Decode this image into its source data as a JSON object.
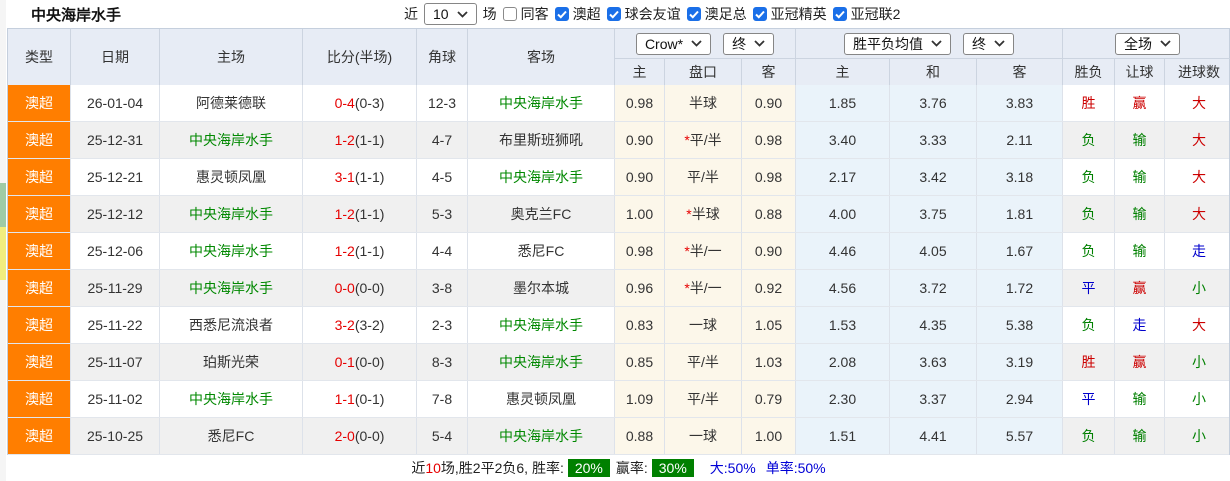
{
  "title": "中央海岸水手",
  "controls": {
    "recent_label": "近",
    "recent_count": "10",
    "unit_label": "场",
    "same_away": {
      "label": "同客",
      "checked": false
    },
    "leagues": [
      {
        "label": "澳超",
        "checked": true
      },
      {
        "label": "球会友谊",
        "checked": true
      },
      {
        "label": "澳足总",
        "checked": true
      },
      {
        "label": "亚冠精英",
        "checked": true
      },
      {
        "label": "亚冠联2",
        "checked": true
      }
    ]
  },
  "table": {
    "left_headers": [
      "类型",
      "日期",
      "主场",
      "比分(半场)",
      "角球",
      "客场"
    ],
    "dropdowns": {
      "bookmaker": "Crow*",
      "bookmaker_time": "终",
      "average": "胜平负均值",
      "average_time": "终",
      "scope": "全场"
    },
    "sub_headers": [
      "主",
      "盘口",
      "客",
      "主",
      "和",
      "客",
      "胜负",
      "让球",
      "进球数"
    ],
    "rows": [
      {
        "league": "澳超",
        "date": "26-01-04",
        "home": "阿德莱德联",
        "home_self": false,
        "score_ft": "0-4",
        "score_ht": "(0-3)",
        "corner": "12-3",
        "away": "中央海岸水手",
        "away_self": true,
        "odds_home": "0.98",
        "handicap_star": "",
        "handicap": "半球",
        "odds_away": "0.90",
        "avg_home": "1.85",
        "avg_draw": "3.76",
        "avg_away": "3.83",
        "result": "胜",
        "result_color": "red",
        "handicap_result": "赢",
        "handicap_result_color": "red",
        "goals": "大",
        "goals_color": "red"
      },
      {
        "league": "澳超",
        "date": "25-12-31",
        "home": "中央海岸水手",
        "home_self": true,
        "score_ft": "1-2",
        "score_ht": "(1-1)",
        "corner": "4-7",
        "away": "布里斯班狮吼",
        "away_self": false,
        "odds_home": "0.90",
        "handicap_star": "*",
        "handicap": "平/半",
        "odds_away": "0.98",
        "avg_home": "3.40",
        "avg_draw": "3.33",
        "avg_away": "2.11",
        "result": "负",
        "result_color": "green",
        "handicap_result": "输",
        "handicap_result_color": "green",
        "goals": "大",
        "goals_color": "red"
      },
      {
        "league": "澳超",
        "date": "25-12-21",
        "home": "惠灵顿凤凰",
        "home_self": false,
        "score_ft": "3-1",
        "score_ht": "(1-1)",
        "corner": "4-5",
        "away": "中央海岸水手",
        "away_self": true,
        "odds_home": "0.90",
        "handicap_star": "",
        "handicap": "平/半",
        "odds_away": "0.98",
        "avg_home": "2.17",
        "avg_draw": "3.42",
        "avg_away": "3.18",
        "result": "负",
        "result_color": "green",
        "handicap_result": "输",
        "handicap_result_color": "green",
        "goals": "大",
        "goals_color": "red"
      },
      {
        "league": "澳超",
        "date": "25-12-12",
        "home": "中央海岸水手",
        "home_self": true,
        "score_ft": "1-2",
        "score_ht": "(1-1)",
        "corner": "5-3",
        "away": "奥克兰FC",
        "away_self": false,
        "odds_home": "1.00",
        "handicap_star": "*",
        "handicap": "半球",
        "odds_away": "0.88",
        "avg_home": "4.00",
        "avg_draw": "3.75",
        "avg_away": "1.81",
        "result": "负",
        "result_color": "green",
        "handicap_result": "输",
        "handicap_result_color": "green",
        "goals": "大",
        "goals_color": "red"
      },
      {
        "league": "澳超",
        "date": "25-12-06",
        "home": "中央海岸水手",
        "home_self": true,
        "score_ft": "1-2",
        "score_ht": "(1-1)",
        "corner": "4-4",
        "away": "悉尼FC",
        "away_self": false,
        "odds_home": "0.98",
        "handicap_star": "*",
        "handicap": "半/一",
        "odds_away": "0.90",
        "avg_home": "4.46",
        "avg_draw": "4.05",
        "avg_away": "1.67",
        "result": "负",
        "result_color": "green",
        "handicap_result": "输",
        "handicap_result_color": "green",
        "goals": "走",
        "goals_color": "blue"
      },
      {
        "league": "澳超",
        "date": "25-11-29",
        "home": "中央海岸水手",
        "home_self": true,
        "score_ft": "0-0",
        "score_ht": "(0-0)",
        "corner": "3-8",
        "away": "墨尔本城",
        "away_self": false,
        "odds_home": "0.96",
        "handicap_star": "*",
        "handicap": "半/一",
        "odds_away": "0.92",
        "avg_home": "4.56",
        "avg_draw": "3.72",
        "avg_away": "1.72",
        "result": "平",
        "result_color": "blue",
        "handicap_result": "赢",
        "handicap_result_color": "red",
        "goals": "小",
        "goals_color": "green"
      },
      {
        "league": "澳超",
        "date": "25-11-22",
        "home": "西悉尼流浪者",
        "home_self": false,
        "score_ft": "3-2",
        "score_ht": "(3-2)",
        "corner": "2-3",
        "away": "中央海岸水手",
        "away_self": true,
        "odds_home": "0.83",
        "handicap_star": "",
        "handicap": "一球",
        "odds_away": "1.05",
        "avg_home": "1.53",
        "avg_draw": "4.35",
        "avg_away": "5.38",
        "result": "负",
        "result_color": "green",
        "handicap_result": "走",
        "handicap_result_color": "blue",
        "goals": "大",
        "goals_color": "red"
      },
      {
        "league": "澳超",
        "date": "25-11-07",
        "home": "珀斯光荣",
        "home_self": false,
        "score_ft": "0-1",
        "score_ht": "(0-0)",
        "corner": "8-3",
        "away": "中央海岸水手",
        "away_self": true,
        "odds_home": "0.85",
        "handicap_star": "",
        "handicap": "平/半",
        "odds_away": "1.03",
        "avg_home": "2.08",
        "avg_draw": "3.63",
        "avg_away": "3.19",
        "result": "胜",
        "result_color": "red",
        "handicap_result": "赢",
        "handicap_result_color": "red",
        "goals": "小",
        "goals_color": "green"
      },
      {
        "league": "澳超",
        "date": "25-11-02",
        "home": "中央海岸水手",
        "home_self": true,
        "score_ft": "1-1",
        "score_ht": "(0-1)",
        "corner": "7-8",
        "away": "惠灵顿凤凰",
        "away_self": false,
        "odds_home": "1.09",
        "handicap_star": "",
        "handicap": "平/半",
        "odds_away": "0.79",
        "avg_home": "2.30",
        "avg_draw": "3.37",
        "avg_away": "2.94",
        "result": "平",
        "result_color": "blue",
        "handicap_result": "输",
        "handicap_result_color": "green",
        "goals": "小",
        "goals_color": "green"
      },
      {
        "league": "澳超",
        "date": "25-10-25",
        "home": "悉尼FC",
        "home_self": false,
        "score_ft": "2-0",
        "score_ht": "(0-0)",
        "corner": "5-4",
        "away": "中央海岸水手",
        "away_self": true,
        "odds_home": "0.88",
        "handicap_star": "",
        "handicap": "一球",
        "odds_away": "1.00",
        "avg_home": "1.51",
        "avg_draw": "4.41",
        "avg_away": "5.57",
        "result": "负",
        "result_color": "green",
        "handicap_result": "输",
        "handicap_result_color": "green",
        "goals": "小",
        "goals_color": "green"
      }
    ]
  },
  "footer": {
    "prefix": "近",
    "count": "10",
    "summary": "场,胜2平2负6, 胜率:",
    "win_rate": "20%",
    "handicap_label": "赢率:",
    "handicap_rate": "30%",
    "big_stat": "大:50%",
    "single_stat": "单率:50%"
  },
  "colors": {
    "league_badge_orange": "#ff7e00",
    "result_red": "#cc0000",
    "result_green": "#008000",
    "result_blue": "#0000cc",
    "score_red": "#e60000",
    "self_team_green": "#008800",
    "rate_badge_green": "#008000",
    "checkbox_blue": "#1a6fe8",
    "header_bg": "#e7ecf5"
  }
}
